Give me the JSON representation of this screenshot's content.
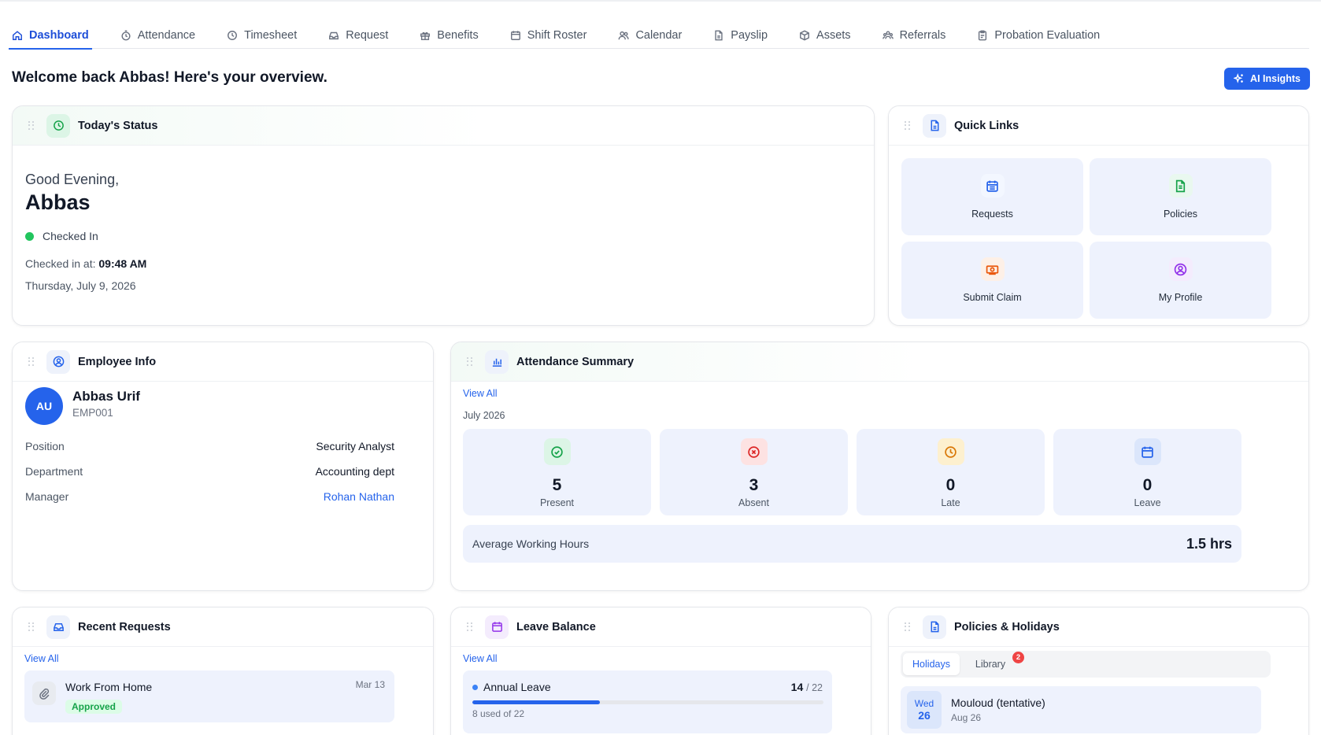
{
  "nav": {
    "tabs": [
      {
        "label": "Dashboard",
        "icon": "home-icon"
      },
      {
        "label": "Attendance",
        "icon": "timer-icon"
      },
      {
        "label": "Timesheet",
        "icon": "clock-icon"
      },
      {
        "label": "Request",
        "icon": "inbox-icon"
      },
      {
        "label": "Benefits",
        "icon": "gift-icon"
      },
      {
        "label": "Shift Roster",
        "icon": "calendar-icon"
      },
      {
        "label": "Calendar",
        "icon": "users-icon"
      },
      {
        "label": "Payslip",
        "icon": "document-icon"
      },
      {
        "label": "Assets",
        "icon": "box-icon"
      },
      {
        "label": "Referrals",
        "icon": "people-icon"
      },
      {
        "label": "Probation Evaluation",
        "icon": "clipboard-icon"
      }
    ],
    "active_index": 0
  },
  "header": {
    "welcome": "Welcome back Abbas! Here's your overview.",
    "ai_button": "AI Insights"
  },
  "today_status": {
    "title": "Today's Status",
    "greeting": "Good Evening,",
    "name": "Abbas",
    "status": "Checked In",
    "status_color": "#22c55e",
    "checked_in_label": "Checked in at:",
    "checked_in_time": "09:48 AM",
    "date": "Thursday, July 9, 2026"
  },
  "quick_links": {
    "title": "Quick Links",
    "items": [
      {
        "label": "Requests",
        "icon": "calendar-list-icon",
        "color": "#2563eb"
      },
      {
        "label": "Policies",
        "icon": "file-text-icon",
        "color": "#16a34a"
      },
      {
        "label": "Submit Claim",
        "icon": "money-icon",
        "color": "#ea580c"
      },
      {
        "label": "My Profile",
        "icon": "user-circle-icon",
        "color": "#9333ea"
      }
    ]
  },
  "employee_info": {
    "title": "Employee Info",
    "initials": "AU",
    "name": "Abbas Urif",
    "emp_id": "EMP001",
    "rows": [
      {
        "key": "Position",
        "value": "Security Analyst"
      },
      {
        "key": "Department",
        "value": "Accounting dept"
      },
      {
        "key": "Manager",
        "value": "Rohan Nathan"
      }
    ]
  },
  "attendance_summary": {
    "title": "Attendance Summary",
    "view_all": "View All",
    "month": "July 2026",
    "stats": [
      {
        "value": "5",
        "label": "Present",
        "icon": "check-circle-icon",
        "color": "#16a34a",
        "bg": "#dcf5e6"
      },
      {
        "value": "3",
        "label": "Absent",
        "icon": "x-circle-icon",
        "color": "#dc2626",
        "bg": "#fde2e2"
      },
      {
        "value": "0",
        "label": "Late",
        "icon": "clock-icon",
        "color": "#d97706",
        "bg": "#fdf0cf"
      },
      {
        "value": "0",
        "label": "Leave",
        "icon": "calendar-icon",
        "color": "#2563eb",
        "bg": "#dbe6fb"
      }
    ],
    "avg_label": "Average Working Hours",
    "avg_value": "1.5 hrs"
  },
  "recent_requests": {
    "title": "Recent Requests",
    "view_all": "View All",
    "items": [
      {
        "title": "Work From Home",
        "date": "Mar 13",
        "status": "Approved"
      }
    ]
  },
  "leave_balance": {
    "title": "Leave Balance",
    "view_all": "View All",
    "items": [
      {
        "name": "Annual Leave",
        "remaining": "14",
        "total": "/ 22",
        "used_text": "8 used of 22",
        "fraction_remaining": 0.3636
      }
    ]
  },
  "policies_holidays": {
    "title": "Policies & Holidays",
    "tabs": [
      "Holidays",
      "Library"
    ],
    "library_badge": "2",
    "holidays": [
      {
        "day": "Wed",
        "num": "26",
        "name": "Mouloud (tentative)",
        "date": "Aug 26"
      }
    ]
  }
}
